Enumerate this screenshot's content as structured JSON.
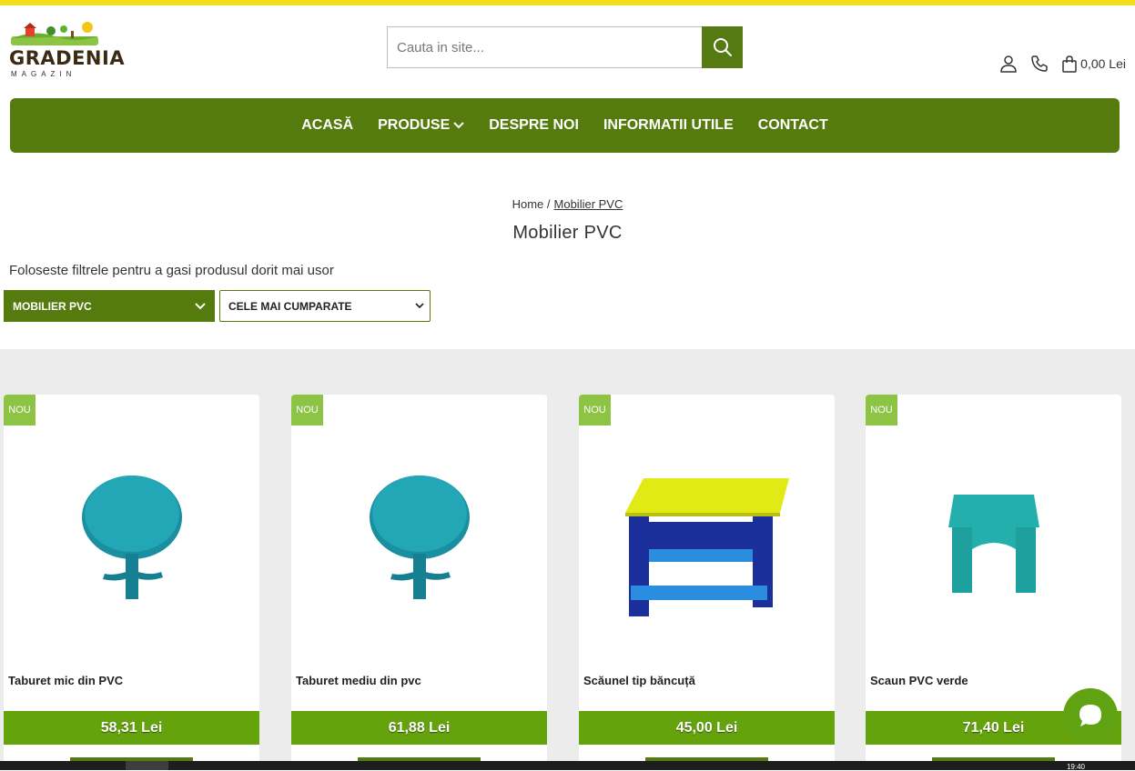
{
  "site": {
    "logo_text": "GRADENIA",
    "logo_sub": "MAGAZIN"
  },
  "search": {
    "placeholder": "Cauta in site..."
  },
  "header": {
    "cart_total": "0,00 Lei"
  },
  "nav": {
    "items": [
      {
        "label": "ACASĂ"
      },
      {
        "label": "PRODUSE"
      },
      {
        "label": "DESPRE NOI"
      },
      {
        "label": "INFORMATII UTILE"
      },
      {
        "label": "CONTACT"
      }
    ]
  },
  "breadcrumb": {
    "home": "Home /",
    "current": "Mobilier PVC"
  },
  "page": {
    "title": "Mobilier PVC",
    "filter_hint": "Foloseste filtrele pentru a gasi produsul dorit mai usor"
  },
  "filters": {
    "category": "MOBILIER PVC",
    "sort": "CELE MAI CUMPARATE"
  },
  "products": [
    {
      "badge": "NOU",
      "name": "Taburet mic din PVC",
      "price": "58,31 Lei",
      "image": "round-table-teal"
    },
    {
      "badge": "NOU",
      "name": "Taburet mediu din pvc",
      "price": "61,88 Lei",
      "image": "round-table-teal"
    },
    {
      "badge": "NOU",
      "name": "Scăunel tip băncuță",
      "price": "45,00 Lei",
      "image": "bench-yellow-blue"
    },
    {
      "badge": "NOU",
      "name": "Scaun PVC verde",
      "price": "71,40 Lei",
      "image": "stool-teal"
    }
  ],
  "taskbar": {
    "clock": "19:40"
  },
  "colors": {
    "brand_green": "#557a0d",
    "price_green": "#65a30d",
    "badge_green": "#8dc446",
    "top_bar_yellow": "#f5dc1f"
  }
}
